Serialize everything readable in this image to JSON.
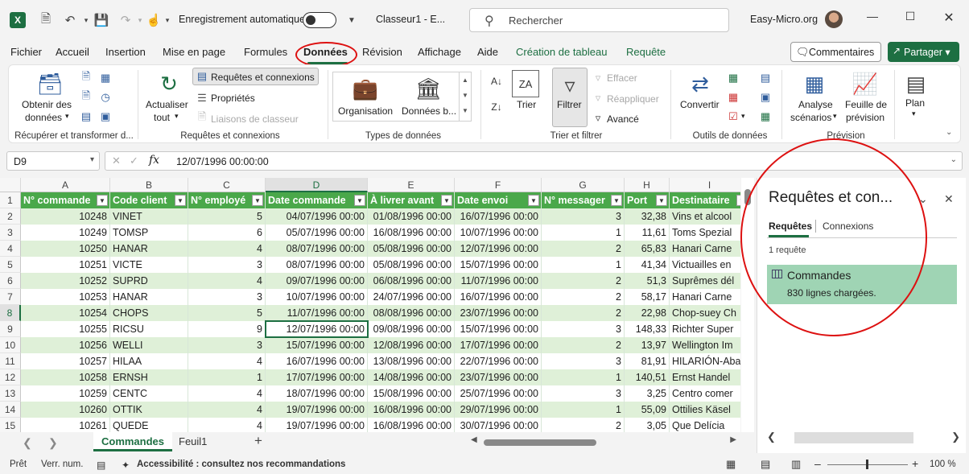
{
  "titlebar": {
    "autosave_label": "Enregistrement automatique",
    "doc_title": "Classeur1  -  E...",
    "search_placeholder": "Rechercher",
    "account": "Easy-Micro.org"
  },
  "menu": [
    "Fichier",
    "Accueil",
    "Insertion",
    "Mise en page",
    "Formules",
    "Données",
    "Révision",
    "Affichage",
    "Aide",
    "Création de tableau",
    "Requête"
  ],
  "menu_active": "Données",
  "buttons": {
    "comments": "Commentaires",
    "share": "Partager"
  },
  "ribbon": {
    "get_data_l1": "Obtenir des",
    "get_data_l2": "données",
    "group_get": "Récupérer et transformer d...",
    "refresh_l1": "Actualiser",
    "refresh_l2": "tout",
    "queries_connections": "Requêtes et connexions",
    "properties": "Propriétés",
    "workbook_links": "Liaisons de classeur",
    "group_queries": "Requêtes et connexions",
    "dt_org": "Organisation",
    "dt_stocks": "Données b...",
    "group_datatypes": "Types de données",
    "sort": "Trier",
    "filter": "Filtrer",
    "clear": "Effacer",
    "reapply": "Réappliquer",
    "advanced": "Avancé",
    "group_sortfilter": "Trier et filtrer",
    "convert": "Convertir",
    "group_datatools": "Outils de données",
    "whatif_l1": "Analyse",
    "whatif_l2": "scénarios",
    "forecast_l1": "Feuille de",
    "forecast_l2": "prévision",
    "group_forecast": "Prévision",
    "outline": "Plan"
  },
  "formula_bar": {
    "name_box": "D9",
    "value": "12/07/1996  00:00:00"
  },
  "columns": [
    "A",
    "B",
    "C",
    "D",
    "E",
    "F",
    "G",
    "H",
    "I"
  ],
  "table_headers": [
    "N° commande",
    "Code client",
    "N° employé",
    "Date commande",
    "À livrer avant",
    "Date envoi",
    "N° messager",
    "Port",
    "Destinataire"
  ],
  "rows": [
    [
      "10248",
      "VINET",
      "5",
      "04/07/1996 00:00",
      "01/08/1996 00:00",
      "16/07/1996 00:00",
      "3",
      "32,38",
      "Vins et alcool"
    ],
    [
      "10249",
      "TOMSP",
      "6",
      "05/07/1996 00:00",
      "16/08/1996 00:00",
      "10/07/1996 00:00",
      "1",
      "11,61",
      "Toms Spezial"
    ],
    [
      "10250",
      "HANAR",
      "4",
      "08/07/1996 00:00",
      "05/08/1996 00:00",
      "12/07/1996 00:00",
      "2",
      "65,83",
      "Hanari Carne"
    ],
    [
      "10251",
      "VICTE",
      "3",
      "08/07/1996 00:00",
      "05/08/1996 00:00",
      "15/07/1996 00:00",
      "1",
      "41,34",
      "Victuailles en"
    ],
    [
      "10252",
      "SUPRD",
      "4",
      "09/07/1996 00:00",
      "06/08/1996 00:00",
      "11/07/1996 00:00",
      "2",
      "51,3",
      "Suprêmes dél"
    ],
    [
      "10253",
      "HANAR",
      "3",
      "10/07/1996 00:00",
      "24/07/1996 00:00",
      "16/07/1996 00:00",
      "2",
      "58,17",
      "Hanari Carne"
    ],
    [
      "10254",
      "CHOPS",
      "5",
      "11/07/1996 00:00",
      "08/08/1996 00:00",
      "23/07/1996 00:00",
      "2",
      "22,98",
      "Chop-suey Ch"
    ],
    [
      "10255",
      "RICSU",
      "9",
      "12/07/1996 00:00",
      "09/08/1996 00:00",
      "15/07/1996 00:00",
      "3",
      "148,33",
      "Richter Super"
    ],
    [
      "10256",
      "WELLI",
      "3",
      "15/07/1996 00:00",
      "12/08/1996 00:00",
      "17/07/1996 00:00",
      "2",
      "13,97",
      "Wellington Im"
    ],
    [
      "10257",
      "HILAA",
      "4",
      "16/07/1996 00:00",
      "13/08/1996 00:00",
      "22/07/1996 00:00",
      "3",
      "81,91",
      "HILARIÓN-Aba"
    ],
    [
      "10258",
      "ERNSH",
      "1",
      "17/07/1996 00:00",
      "14/08/1996 00:00",
      "23/07/1996 00:00",
      "1",
      "140,51",
      "Ernst Handel"
    ],
    [
      "10259",
      "CENTC",
      "4",
      "18/07/1996 00:00",
      "15/08/1996 00:00",
      "25/07/1996 00:00",
      "3",
      "3,25",
      "Centro comer"
    ],
    [
      "10260",
      "OTTIK",
      "4",
      "19/07/1996 00:00",
      "16/08/1996 00:00",
      "29/07/1996 00:00",
      "1",
      "55,09",
      "Ottilies Käsel"
    ],
    [
      "10261",
      "QUEDE",
      "4",
      "19/07/1996 00:00",
      "16/08/1996 00:00",
      "30/07/1996 00:00",
      "2",
      "3,05",
      "Que Delícia"
    ]
  ],
  "sheets": {
    "active": "Commandes",
    "other": "Feuil1"
  },
  "panel": {
    "title": "Requêtes et con...",
    "tab_queries": "Requêtes",
    "tab_connections": "Connexions",
    "count": "1 requête",
    "query_name": "Commandes",
    "query_status": "830 lignes chargées."
  },
  "status": {
    "ready": "Prêt",
    "numlock": "Verr. num.",
    "accessibility": "Accessibilité : consultez nos recommandations",
    "zoom": "100 %"
  },
  "colors": {
    "excel_green": "#1d6f42",
    "table_header": "#4aa84a",
    "band": "#dff0d8",
    "annotation": "#dd1111"
  }
}
